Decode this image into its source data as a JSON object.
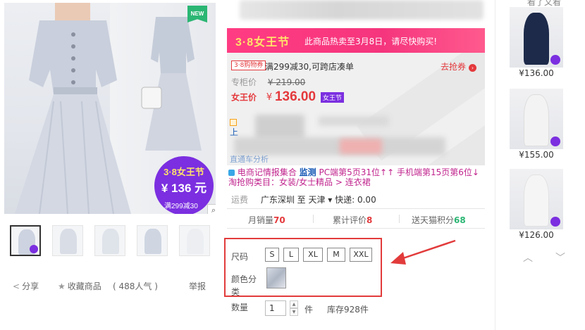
{
  "gallery": {
    "new_tag": "NEW",
    "promo_title": "3·8女王节",
    "promo_price": "¥ 136 元",
    "promo_sub": "满299减30",
    "zoom_icon": "magnifier-icon",
    "thumb_count": 5
  },
  "actions": {
    "share": "分享",
    "favorite": "收藏商品",
    "popularity": "( 488人气 )",
    "report": "举报"
  },
  "banner": {
    "logo": "3·8女王节",
    "text": "此商品热卖至3月8日，请尽快购买!"
  },
  "coupon": {
    "tag": "3·8购物券",
    "text": "满299减30,可跨店凑单",
    "get_label": "去抢券"
  },
  "prices": {
    "original_label": "专柜价",
    "original_value": "¥ 219.00",
    "current_label": "女王价",
    "currency": "¥",
    "current_value": "136.00",
    "badge": "女王节"
  },
  "partial_text": {
    "line1": "上",
    "line2": "直通车分析"
  },
  "intel": {
    "line1_prefix": "电商记情报集合",
    "line1_monitor": "监测",
    "line1_pc": "PC端第5页31位↑↑",
    "line1_mobile": "手机端第15页第6位↓",
    "line2": "淘抢购类目：女装/女士精品 > 连衣裙"
  },
  "shipping": {
    "label": "运费",
    "route": "广东深圳 至 天津 ▾ 快递: 0.00"
  },
  "stats": {
    "monthly_label": "月销量",
    "monthly_value": "70",
    "reviews_label": "累计评价",
    "reviews_value": "8",
    "points_label": "送天猫积分",
    "points_value": "68"
  },
  "sku": {
    "size_label": "尺码",
    "sizes": [
      "S",
      "L",
      "XL",
      "M",
      "XXL"
    ],
    "color_label_1": "颜色分",
    "color_label_2": "类"
  },
  "quantity": {
    "label": "数量",
    "value": "1",
    "unit": "件",
    "stock": "库存928件"
  },
  "recommendations": {
    "title": "看了又看",
    "items": [
      {
        "price": "¥136.00"
      },
      {
        "price": "¥155.00"
      },
      {
        "price": "¥126.00"
      }
    ],
    "up_icon": "chevron-up-icon",
    "down_icon": "chevron-down-icon"
  },
  "colors": {
    "promo_purple": "#7b2fe0",
    "banner_pink": "#ff3c83",
    "price_red": "#e4393c",
    "highlight_box": "#e23b3b",
    "points_green": "#2bb673"
  }
}
